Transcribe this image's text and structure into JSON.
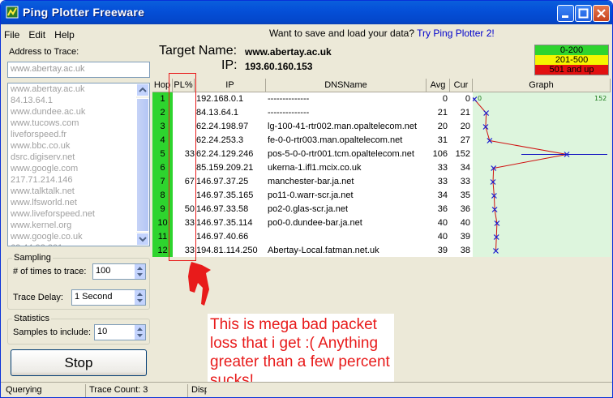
{
  "window": {
    "title": "Ping Plotter Freeware"
  },
  "menu": [
    "File",
    "Edit",
    "Help"
  ],
  "promo": {
    "text": "Want to save and load your data?",
    "link": "Try Ping Plotter 2!"
  },
  "address": {
    "label": "Address to Trace:",
    "value": "www.abertay.ac.uk"
  },
  "history": [
    "www.abertay.ac.uk",
    "84.13.64.1",
    "www.dundee.ac.uk",
    "www.tucows.com",
    "liveforspeed.fr",
    "www.bbc.co.uk",
    "dsrc.digiserv.net",
    "www.google.com",
    "217.71.214.146",
    "www.talktalk.net",
    "www.lfsworld.net",
    "www.liveforspeed.net",
    "www.kernel.org",
    "www.google.co.uk",
    "62.44.93.201"
  ],
  "sampling": {
    "title": "Sampling",
    "times_label": "# of times to trace:",
    "times_value": "100",
    "delay_label": "Trace Delay:",
    "delay_value": "1 Second"
  },
  "statistics": {
    "title": "Statistics",
    "samples_label": "Samples to include:",
    "samples_value": "10"
  },
  "stop_button": "Stop",
  "status": {
    "state": "Querying",
    "trace_count": "Trace Count: 3",
    "display": "Display"
  },
  "target": {
    "name_label": "Target Name:",
    "name_value": "www.abertay.ac.uk",
    "ip_label": "IP:",
    "ip_value": "193.60.160.153"
  },
  "legend": [
    {
      "text": "0-200",
      "color": "#f5f500"
    },
    {
      "text": "201-500",
      "color": "#f5f500"
    },
    {
      "text": "501 and up",
      "color": "#e21010"
    }
  ],
  "columns": [
    "Hop",
    "PL%",
    "IP",
    "DNSName",
    "Avg",
    "Cur",
    "Graph"
  ],
  "graph": {
    "min_label": "0",
    "max_label": "152",
    "max_ms": 152
  },
  "hops": [
    {
      "hop": "1",
      "pl": "",
      "ip": "192.168.0.1",
      "dns": "--------------",
      "avg": "0",
      "cur": "0",
      "cur_ms": 0
    },
    {
      "hop": "2",
      "pl": "",
      "ip": "84.13.64.1",
      "dns": "--------------",
      "avg": "21",
      "cur": "21",
      "cur_ms": 21
    },
    {
      "hop": "3",
      "pl": "",
      "ip": "62.24.198.97",
      "dns": "lg-100-41-rtr002.man.opaltelecom.net",
      "avg": "20",
      "cur": "20",
      "cur_ms": 20
    },
    {
      "hop": "4",
      "pl": "",
      "ip": "62.24.253.3",
      "dns": "fe-0-0-rtr003.man.opaltelecom.net",
      "avg": "31",
      "cur": "27",
      "cur_ms": 27
    },
    {
      "hop": "5",
      "pl": "33",
      "ip": "62.24.129.246",
      "dns": "pos-5-0-0-rtr001.tcm.opaltelecom.net",
      "avg": "106",
      "cur": "152",
      "cur_ms": 152
    },
    {
      "hop": "6",
      "pl": "",
      "ip": "85.159.209.21",
      "dns": "ukerna-1.ifl1.mcix.co.uk",
      "avg": "33",
      "cur": "34",
      "cur_ms": 34
    },
    {
      "hop": "7",
      "pl": "67",
      "ip": "146.97.37.25",
      "dns": "manchester-bar.ja.net",
      "avg": "33",
      "cur": "33",
      "cur_ms": 33
    },
    {
      "hop": "8",
      "pl": "",
      "ip": "146.97.35.165",
      "dns": "po11-0.warr-scr.ja.net",
      "avg": "34",
      "cur": "35",
      "cur_ms": 35
    },
    {
      "hop": "9",
      "pl": "50",
      "ip": "146.97.33.58",
      "dns": "po2-0.glas-scr.ja.net",
      "avg": "36",
      "cur": "36",
      "cur_ms": 36
    },
    {
      "hop": "10",
      "pl": "33",
      "ip": "146.97.35.114",
      "dns": "po0-0.dundee-bar.ja.net",
      "avg": "40",
      "cur": "40",
      "cur_ms": 40
    },
    {
      "hop": "11",
      "pl": "",
      "ip": "146.97.40.66",
      "dns": "",
      "avg": "40",
      "cur": "39",
      "cur_ms": 39
    },
    {
      "hop": "12",
      "pl": "33",
      "ip": "194.81.114.250",
      "dns": "Abertay-Local.fatman.net.uk",
      "avg": "39",
      "cur": "38",
      "cur_ms": 38
    }
  ],
  "annotation": "This is mega bad packet loss that i get :( Anything greater than a few percent sucks!",
  "colors": {
    "hop_green": "#2ed42e",
    "annotation_red": "#e81b1b",
    "graph_bg": "#ddf5dd"
  }
}
